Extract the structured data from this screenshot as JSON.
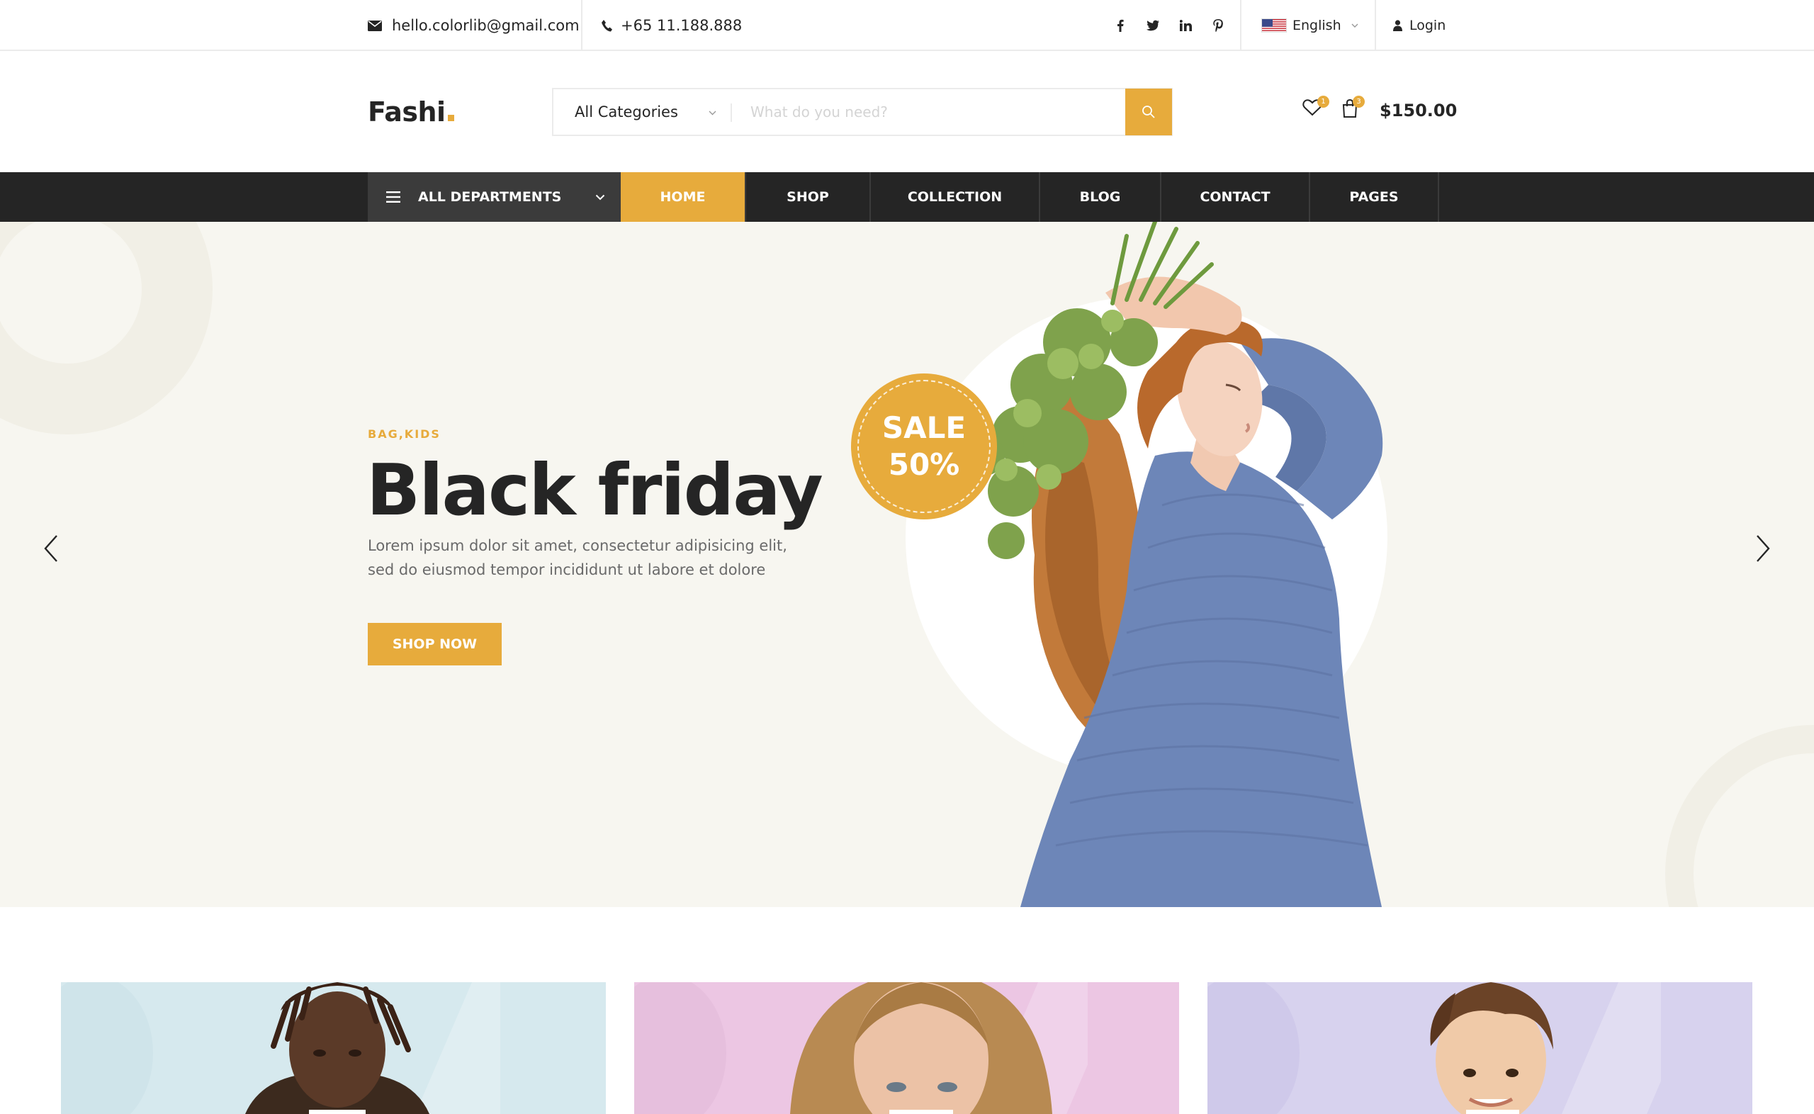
{
  "topbar": {
    "email": "hello.colorlib@gmail.com",
    "phone": "+65 11.188.888",
    "social_icons": [
      "facebook-icon",
      "twitter-icon",
      "linkedin-icon",
      "pinterest-icon"
    ],
    "language": "English",
    "login": "Login"
  },
  "header": {
    "logo": "Fashi",
    "search": {
      "category": "All Categories",
      "placeholder": "What do you need?"
    },
    "wishlist_count": "1",
    "cart_count": "3",
    "cart_total": "$150.00"
  },
  "nav": {
    "departments": "ALL DEPARTMENTS",
    "items": [
      "HOME",
      "SHOP",
      "COLLECTION",
      "BLOG",
      "CONTACT",
      "PAGES"
    ],
    "active": "HOME"
  },
  "hero": {
    "tag": "BAG,KIDS",
    "title": "Black friday",
    "text": "Lorem ipsum dolor sit amet, consectetur adipisicing elit, sed do eiusmod tempor incididunt ut labore et dolore",
    "button": "SHOP NOW",
    "sale_line1": "SALE",
    "sale_line2": "50%"
  },
  "colors": {
    "accent": "#e7ab3c",
    "dark": "#252525",
    "hero_bg": "#f7f6f0",
    "banner_men": "#d6e9ee",
    "banner_women": "#ecc6e3",
    "banner_kids": "#d7d2ee"
  }
}
